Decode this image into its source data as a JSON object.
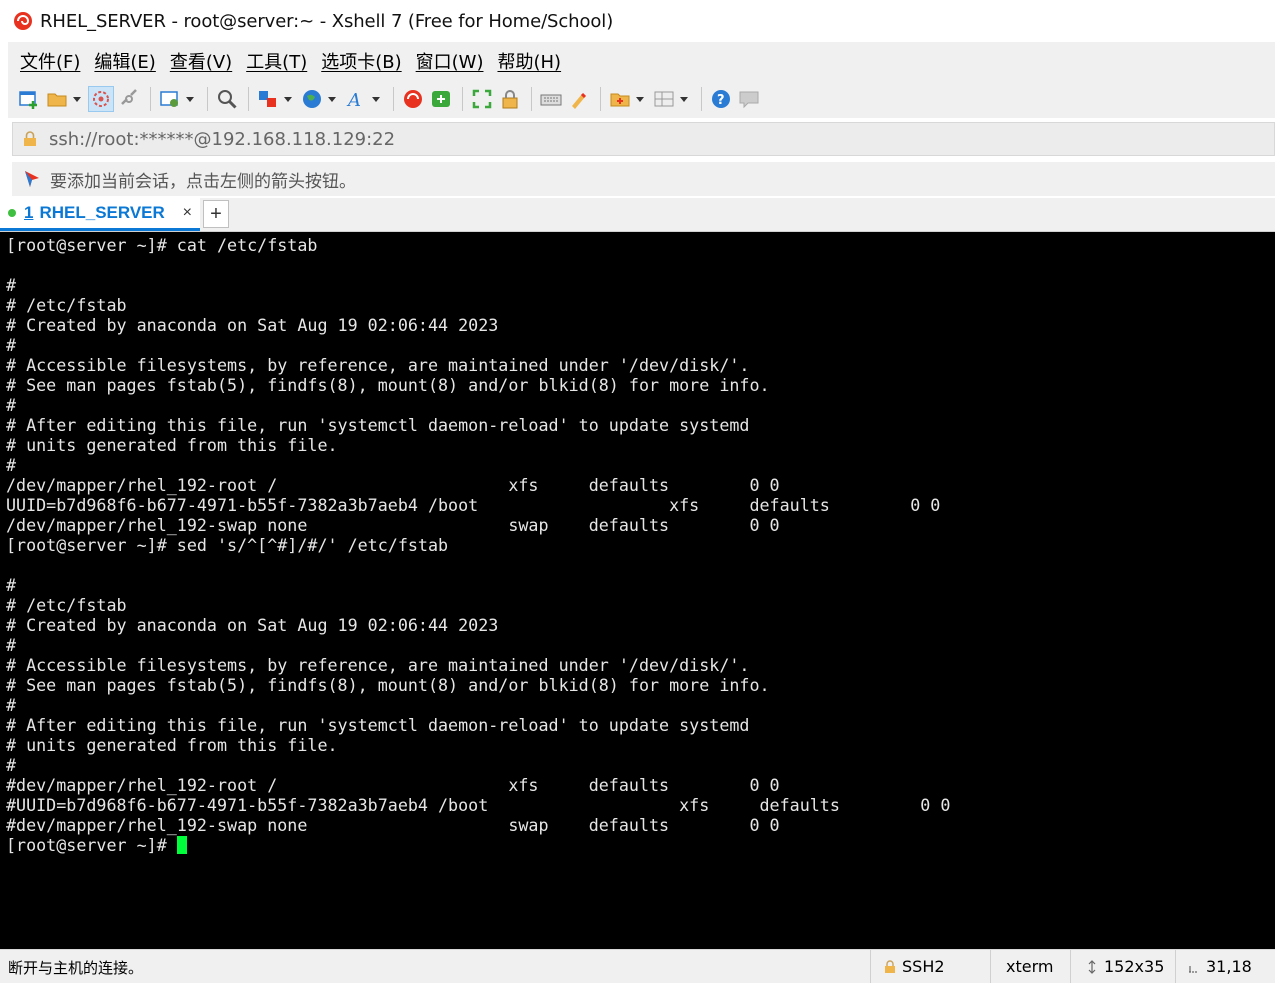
{
  "window": {
    "title": "RHEL_SERVER - root@server:~ - Xshell 7 (Free for Home/School)"
  },
  "menu": [
    {
      "label": "文件(F)"
    },
    {
      "label": "编辑(E)"
    },
    {
      "label": "查看(V)"
    },
    {
      "label": "工具(T)"
    },
    {
      "label": "选项卡(B)"
    },
    {
      "label": "窗口(W)"
    },
    {
      "label": "帮助(H)"
    }
  ],
  "address": {
    "value": "ssh://root:******@192.168.118.129:22"
  },
  "hint": {
    "text": "要添加当前会话，点击左侧的箭头按钮。"
  },
  "tab": {
    "number": "1",
    "label": "RHEL_SERVER",
    "close": "×",
    "add": "+"
  },
  "terminal": {
    "lines": [
      "[root@server ~]# cat /etc/fstab",
      "",
      "#",
      "# /etc/fstab",
      "# Created by anaconda on Sat Aug 19 02:06:44 2023",
      "#",
      "# Accessible filesystems, by reference, are maintained under '/dev/disk/'.",
      "# See man pages fstab(5), findfs(8), mount(8) and/or blkid(8) for more info.",
      "#",
      "# After editing this file, run 'systemctl daemon-reload' to update systemd",
      "# units generated from this file.",
      "#",
      "/dev/mapper/rhel_192-root /                       xfs     defaults        0 0",
      "UUID=b7d968f6-b677-4971-b55f-7382a3b7aeb4 /boot                   xfs     defaults        0 0",
      "/dev/mapper/rhel_192-swap none                    swap    defaults        0 0",
      "[root@server ~]# sed 's/^[^#]/#/' /etc/fstab",
      "",
      "#",
      "# /etc/fstab",
      "# Created by anaconda on Sat Aug 19 02:06:44 2023",
      "#",
      "# Accessible filesystems, by reference, are maintained under '/dev/disk/'.",
      "# See man pages fstab(5), findfs(8), mount(8) and/or blkid(8) for more info.",
      "#",
      "# After editing this file, run 'systemctl daemon-reload' to update systemd",
      "# units generated from this file.",
      "#",
      "#dev/mapper/rhel_192-root /                       xfs     defaults        0 0",
      "#UUID=b7d968f6-b677-4971-b55f-7382a3b7aeb4 /boot                   xfs     defaults        0 0",
      "#dev/mapper/rhel_192-swap none                    swap    defaults        0 0"
    ],
    "prompt": "[root@server ~]# ",
    "cursor_color": "#00ff3a"
  },
  "status": {
    "message": "断开与主机的连接。",
    "protocol": "SSH2",
    "terminal_type": "xterm",
    "size": "152x35",
    "position": "31,18"
  },
  "toolbar_icons": [
    "new-session-icon",
    "open-folder-icon",
    "reconnect-icon",
    "disconnect-icon",
    "properties-icon",
    "find-icon",
    "transfer-icon",
    "globe-icon",
    "font-icon",
    "xshell-icon",
    "xftp-icon",
    "fullscreen-icon",
    "lock-icon",
    "keyboard-icon",
    "highlight-icon",
    "add-folder-icon",
    "layout-icon",
    "help-icon",
    "chat-icon"
  ]
}
